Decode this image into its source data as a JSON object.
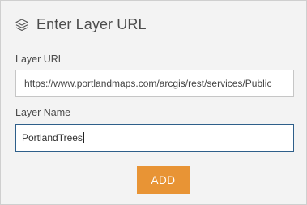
{
  "dialog": {
    "title": "Enter Layer URL",
    "icon": "layers-icon"
  },
  "layer_url": {
    "label": "Layer URL",
    "value": "https://www.portlandmaps.com/arcgis/rest/services/Public"
  },
  "layer_name": {
    "label": "Layer Name",
    "value": "PortlandTrees"
  },
  "actions": {
    "add_label": "ADD"
  },
  "colors": {
    "accent_button": "#e89435",
    "focus_border": "#2e5f8a",
    "panel_bg": "#f3f3f3"
  }
}
